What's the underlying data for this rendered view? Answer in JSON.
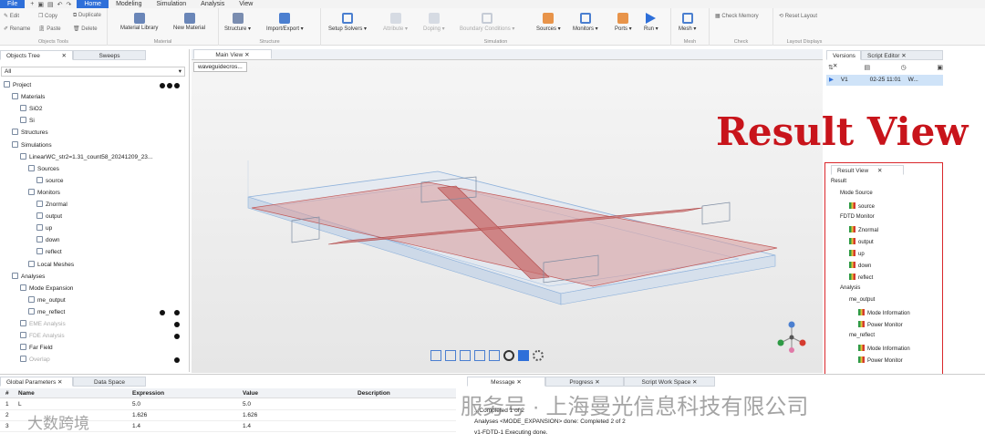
{
  "menubar": {
    "items": [
      "File",
      "Home",
      "Modeling",
      "Simulation",
      "Analysis",
      "View"
    ],
    "active": "Home"
  },
  "ribbon": {
    "objects_tools": {
      "edit": "Edit",
      "copy": "Copy",
      "duplicate": "Duplicate",
      "rename": "Rename",
      "paste": "Paste",
      "delete": "Delete",
      "group": "Objects Tools"
    },
    "material": {
      "library": "Material Library",
      "new": "New Material",
      "group": "Material"
    },
    "structure": {
      "structure": "Structure ▾",
      "import_export": "Import/Export ▾",
      "group": "Structure"
    },
    "simulation": {
      "setup": "Setup Solvers ▾",
      "attribute": "Attribute ▾",
      "doping": "Doping ▾",
      "boundary": "Boundary Conditions ▾",
      "sources": "Sources ▾",
      "monitors": "Monitors ▾",
      "ports": "Ports ▾",
      "run": "Run ▾",
      "group": "Simulation"
    },
    "mesh": {
      "label": "Mesh ▾",
      "group": "Mesh"
    },
    "check": {
      "label": "Check Memory",
      "group": "Check"
    },
    "layout": {
      "label": "Reset Layout",
      "group": "Layout Displays"
    }
  },
  "left_tabs": [
    "Objects Tree",
    "Sweeps"
  ],
  "filter": "All",
  "tree": [
    {
      "label": "Project",
      "indent": 0
    },
    {
      "label": "Materials",
      "indent": 1
    },
    {
      "label": "SiO2",
      "indent": 2
    },
    {
      "label": "Si",
      "indent": 2
    },
    {
      "label": "Structures",
      "indent": 1
    },
    {
      "label": "Simulations",
      "indent": 1
    },
    {
      "label": "LinearWC_str2=1.31_count58_20241209_23...",
      "indent": 2
    },
    {
      "label": "Sources",
      "indent": 3
    },
    {
      "label": "source",
      "indent": 4
    },
    {
      "label": "Monitors",
      "indent": 3
    },
    {
      "label": "Znormal",
      "indent": 4
    },
    {
      "label": "output",
      "indent": 4
    },
    {
      "label": "up",
      "indent": 4
    },
    {
      "label": "down",
      "indent": 4
    },
    {
      "label": "reflect",
      "indent": 4
    },
    {
      "label": "Local Meshes",
      "indent": 3
    },
    {
      "label": "Analyses",
      "indent": 1
    },
    {
      "label": "Mode Expansion",
      "indent": 2
    },
    {
      "label": "me_output",
      "indent": 3
    },
    {
      "label": "me_reflect",
      "indent": 3
    },
    {
      "label": "EME Analysis",
      "indent": 2,
      "dim": true
    },
    {
      "label": "FDE Analysis",
      "indent": 2,
      "dim": true
    },
    {
      "label": "Far Field",
      "indent": 2
    },
    {
      "label": "Overlap",
      "indent": 2,
      "dim": true
    }
  ],
  "main_tabs": {
    "main": "Main View",
    "file": "waveguidecros..."
  },
  "right_tabs": [
    "Versions",
    "Script Editor"
  ],
  "version_row": {
    "name": "V1",
    "time": "02-25 11:01",
    "user": "W..."
  },
  "result_title": "Result View",
  "result_panel": {
    "tab": "Result View",
    "rows": [
      {
        "label": "Result",
        "level": 0
      },
      {
        "label": "Mode Source",
        "level": 1
      },
      {
        "label": "source",
        "level": 2,
        "icon": true
      },
      {
        "label": "FDTD Monitor",
        "level": 1
      },
      {
        "label": "Znormal",
        "level": 2,
        "icon": true
      },
      {
        "label": "output",
        "level": 2,
        "icon": true
      },
      {
        "label": "up",
        "level": 2,
        "icon": true
      },
      {
        "label": "down",
        "level": 2,
        "icon": true
      },
      {
        "label": "reflect",
        "level": 2,
        "icon": true
      },
      {
        "label": "Analysis",
        "level": 1
      },
      {
        "label": "me_output",
        "level": 2
      },
      {
        "label": "Mode Information",
        "level": 3,
        "icon": true
      },
      {
        "label": "Power Monitor",
        "level": 3,
        "icon": true
      },
      {
        "label": "me_reflect",
        "level": 2
      },
      {
        "label": "Mode Information",
        "level": 3,
        "icon": true
      },
      {
        "label": "Power Monitor",
        "level": 3,
        "icon": true
      }
    ]
  },
  "bottom_tabs": [
    "Global Parameters",
    "Data Space"
  ],
  "params_headers": [
    "#",
    "Name",
    "Expression",
    "Value",
    "Description"
  ],
  "params_rows": [
    {
      "n": "1",
      "name": "L",
      "expr": "5.0",
      "value": "5.0"
    },
    {
      "n": "2",
      "name": "",
      "expr": "1.626",
      "value": "1.626"
    },
    {
      "n": "3",
      "name": "",
      "expr": "1.4",
      "value": "1.4"
    }
  ],
  "message_tabs": [
    "Message",
    "Progress",
    "Script Work Space"
  ],
  "messages": [
    "...Completed 1 of 2",
    "Analyses <MODE_EXPANSION> done: Completed 2 of 2",
    "v1-FDTD-1 Executing done."
  ],
  "watermarks": {
    "center": "服务号 · 上海曼光信息科技有限公司",
    "left": "大数跨境"
  }
}
